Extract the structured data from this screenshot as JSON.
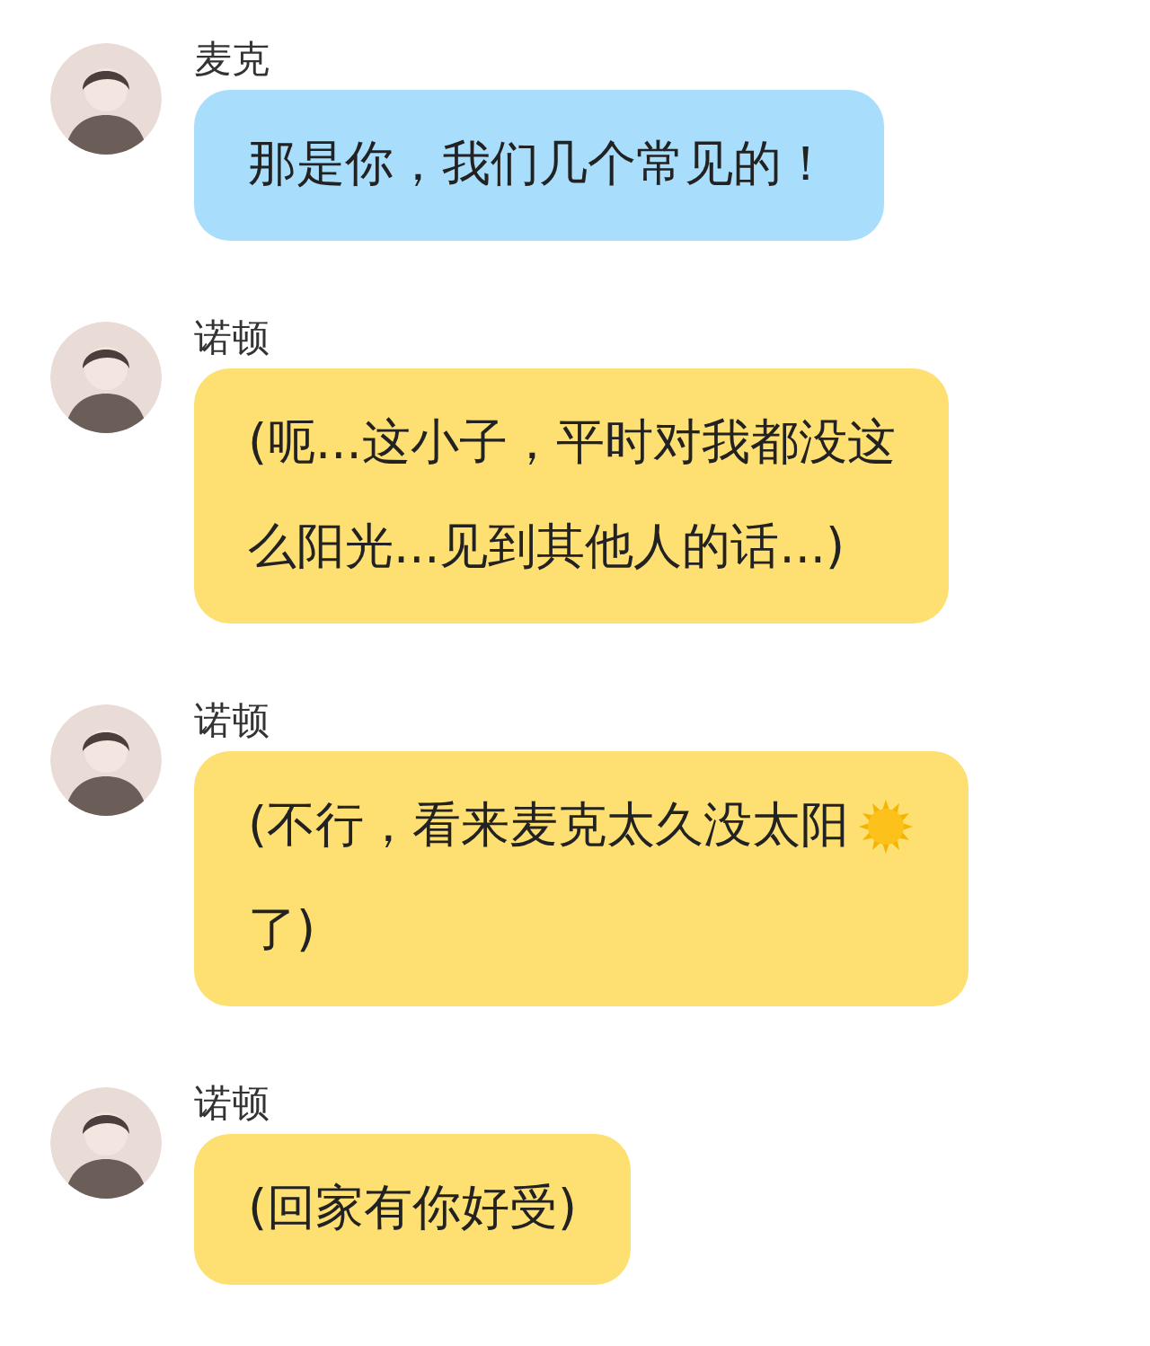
{
  "messages": [
    {
      "sender": "麦克",
      "color": "#a8defb",
      "lines": [
        {
          "kind": "plain",
          "text": "那是你，我们几个常见的！"
        }
      ]
    },
    {
      "sender": "诺顿",
      "color": "#fddf72",
      "lines": [
        {
          "kind": "plain",
          "text": "(呃...这小子，平时对我都没这"
        },
        {
          "kind": "plain",
          "text": "么阳光...见到其他人的话...)"
        }
      ]
    },
    {
      "sender": "诺顿",
      "color": "#fddf72",
      "lines": [
        {
          "kind": "emoji",
          "text": "(不行，看来麦克太久没太阳"
        },
        {
          "kind": "plain",
          "text": "了)"
        }
      ]
    },
    {
      "sender": "诺顿",
      "color": "#fddf72",
      "lines": [
        {
          "kind": "plain",
          "text": "(回家有你好受)"
        }
      ]
    }
  ]
}
